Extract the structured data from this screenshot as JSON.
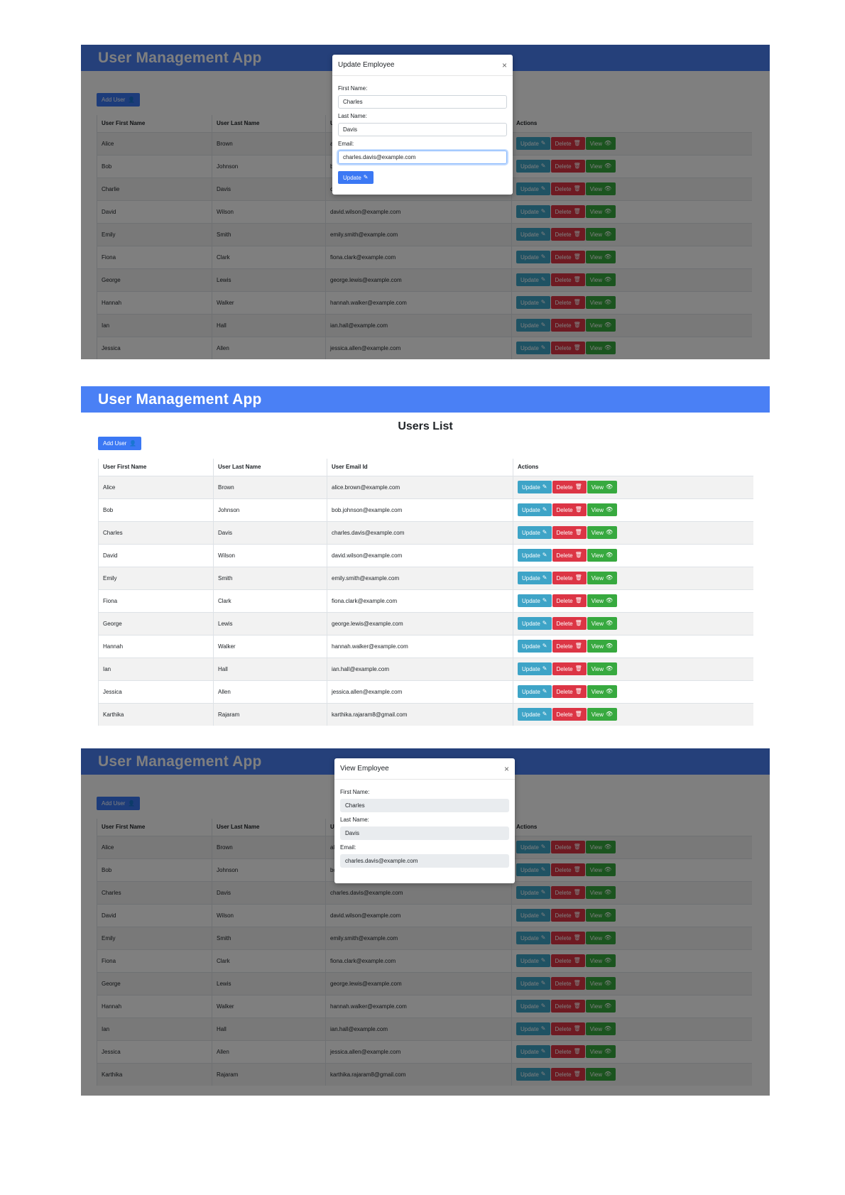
{
  "app": {
    "title": "User Management App"
  },
  "list": {
    "title": "Users List",
    "add_user_label": "Add User",
    "columns": [
      "User First Name",
      "User Last Name",
      "User Email Id",
      "Actions"
    ],
    "actions": {
      "update": "Update",
      "delete": "Delete",
      "view": "View"
    }
  },
  "users_partial": [
    {
      "first": "Alice",
      "last": "Brown",
      "email": "alice.brown@example.com"
    },
    {
      "first": "Bob",
      "last": "Johnson",
      "email": "bob.johnson@example.com"
    },
    {
      "first": "Charlie",
      "last": "Davis",
      "email": "charles.davis@example.com"
    },
    {
      "first": "David",
      "last": "Wilson",
      "email": "david.wilson@example.com"
    },
    {
      "first": "Emily",
      "last": "Smith",
      "email": "emily.smith@example.com"
    },
    {
      "first": "Fiona",
      "last": "Clark",
      "email": "fiona.clark@example.com"
    },
    {
      "first": "George",
      "last": "Lewis",
      "email": "george.lewis@example.com"
    },
    {
      "first": "Hannah",
      "last": "Walker",
      "email": "hannah.walker@example.com"
    },
    {
      "first": "Ian",
      "last": "Hall",
      "email": "ian.hall@example.com"
    },
    {
      "first": "Jessica",
      "last": "Allen",
      "email": "jessica.allen@example.com"
    }
  ],
  "users": [
    {
      "first": "Alice",
      "last": "Brown",
      "email": "alice.brown@example.com"
    },
    {
      "first": "Bob",
      "last": "Johnson",
      "email": "bob.johnson@example.com"
    },
    {
      "first": "Charles",
      "last": "Davis",
      "email": "charles.davis@example.com"
    },
    {
      "first": "David",
      "last": "Wilson",
      "email": "david.wilson@example.com"
    },
    {
      "first": "Emily",
      "last": "Smith",
      "email": "emily.smith@example.com"
    },
    {
      "first": "Fiona",
      "last": "Clark",
      "email": "fiona.clark@example.com"
    },
    {
      "first": "George",
      "last": "Lewis",
      "email": "george.lewis@example.com"
    },
    {
      "first": "Hannah",
      "last": "Walker",
      "email": "hannah.walker@example.com"
    },
    {
      "first": "Ian",
      "last": "Hall",
      "email": "ian.hall@example.com"
    },
    {
      "first": "Jessica",
      "last": "Allen",
      "email": "jessica.allen@example.com"
    },
    {
      "first": "Karthika",
      "last": "Rajaram",
      "email": "karthika.rajaram8@gmail.com"
    }
  ],
  "update_modal": {
    "title": "Update Employee",
    "first_label": "First Name:",
    "first_value": "Charles",
    "last_label": "Last Name:",
    "last_value": "Davis",
    "email_label": "Email:",
    "email_value": "charles.davis@example.com",
    "submit_label": "Update",
    "close_label": "×"
  },
  "view_modal": {
    "title": "View Employee",
    "first_label": "First Name:",
    "first_value": "Charles",
    "last_label": "Last Name:",
    "last_value": "Davis",
    "email_label": "Email:",
    "email_value": "charles.davis@example.com",
    "close_label": "×"
  },
  "icons": {
    "add_user": "user-plus-icon",
    "update": "edit-icon",
    "delete": "trash-icon",
    "view": "eye-icon"
  },
  "colors": {
    "header": "#4a80f5",
    "primary": "#3b78f4",
    "update": "#3ea4c7",
    "delete": "#dc3545",
    "view": "#37a93f"
  }
}
